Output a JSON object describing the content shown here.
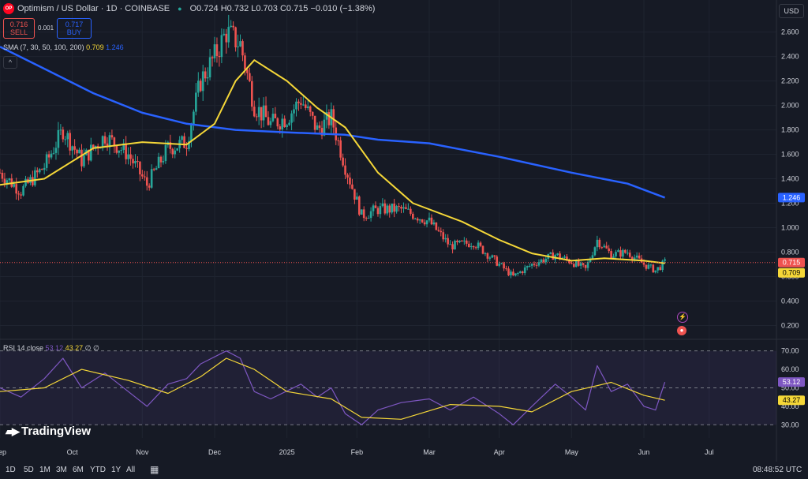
{
  "header": {
    "symbol": "Optimism / US Dollar · 1D · COINBASE",
    "logo": "OP",
    "ohlc": "O0.724 H0.732 L0.703 C0.715 −0.010 (−1.38%)",
    "sell_price": "0.716",
    "sell_label": "SELL",
    "buy_price": "0.717",
    "buy_label": "BUY",
    "spread": "0.001"
  },
  "sma_legend": {
    "label": "SMA (7, 30, 50, 100, 200)",
    "v1": "0.709",
    "v2": "1.246"
  },
  "rsi_legend": {
    "label": "RSI 14 close",
    "v1": "53.12",
    "v2": "43.27",
    "extra": "∅ ∅"
  },
  "currency_button": "USD",
  "watermark": "TradingView",
  "timeframes": [
    "1D",
    "5D",
    "1M",
    "3M",
    "6M",
    "YTD",
    "1Y",
    "All"
  ],
  "clock": "08:48:52 UTC",
  "colors": {
    "up": "#26a69a",
    "down": "#ef5350",
    "sma_fast": "#f5d738",
    "sma_slow": "#2962ff",
    "rsi": "#7e57c2",
    "rsi_ma": "#f5d738"
  },
  "chart_data": [
    {
      "type": "candlestick",
      "title": "Optimism / US Dollar · 1D · COINBASE",
      "x_ticks": [
        "Sep",
        "Oct",
        "Nov",
        "Dec",
        "2025",
        "Feb",
        "Mar",
        "Apr",
        "May",
        "Jun",
        "Jul"
      ],
      "y_ticks": [
        "2.600",
        "2.400",
        "2.200",
        "2.000",
        "1.800",
        "1.600",
        "1.400",
        "1.200",
        "1.000",
        "0.800",
        "0.600",
        "0.400",
        "0.200"
      ],
      "ylim": [
        0.1,
        2.72
      ],
      "price_key": [
        [
          "Sep 1",
          1.45
        ],
        [
          "Sep 10",
          1.3
        ],
        [
          "Sep 20",
          1.5
        ],
        [
          "Sep 28",
          1.8
        ],
        [
          "Oct 5",
          1.55
        ],
        [
          "Oct 15",
          1.75
        ],
        [
          "Oct 25",
          1.6
        ],
        [
          "Nov 3",
          1.35
        ],
        [
          "Nov 12",
          1.65
        ],
        [
          "Nov 20",
          1.7
        ],
        [
          "Nov 26",
          2.2
        ],
        [
          "Dec 1",
          2.4
        ],
        [
          "Dec 6",
          2.6
        ],
        [
          "Dec 12",
          2.5
        ],
        [
          "Dec 18",
          2.0
        ],
        [
          "Dec 25",
          1.85
        ],
        [
          "Jan 1",
          1.9
        ],
        [
          "Jan 7",
          2.05
        ],
        [
          "Jan 14",
          1.8
        ],
        [
          "Jan 20",
          1.9
        ],
        [
          "Jan 26",
          1.5
        ],
        [
          "Feb 3",
          1.1
        ],
        [
          "Feb 10",
          1.15
        ],
        [
          "Feb 20",
          1.15
        ],
        [
          "Mar 1",
          1.05
        ],
        [
          "Mar 10",
          0.85
        ],
        [
          "Mar 20",
          0.88
        ],
        [
          "Apr 1",
          0.7
        ],
        [
          "Apr 7",
          0.6
        ],
        [
          "Apr 15",
          0.7
        ],
        [
          "Apr 25",
          0.78
        ],
        [
          "May 1",
          0.72
        ],
        [
          "May 7",
          0.66
        ],
        [
          "May 12",
          0.9
        ],
        [
          "May 18",
          0.78
        ],
        [
          "May 25",
          0.8
        ],
        [
          "Jun 1",
          0.7
        ],
        [
          "Jun 6",
          0.65
        ],
        [
          "Jun 10",
          0.715
        ]
      ],
      "sma_fast": [
        [
          "Sep 1",
          1.35
        ],
        [
          "Sep 20",
          1.4
        ],
        [
          "Oct 10",
          1.65
        ],
        [
          "Nov 1",
          1.7
        ],
        [
          "Nov 20",
          1.68
        ],
        [
          "Dec 1",
          1.85
        ],
        [
          "Dec 10",
          2.2
        ],
        [
          "Dec 18",
          2.37
        ],
        [
          "Jan 1",
          2.2
        ],
        [
          "Jan 14",
          1.98
        ],
        [
          "Jan 26",
          1.82
        ],
        [
          "Feb 10",
          1.45
        ],
        [
          "Feb 25",
          1.2
        ],
        [
          "Mar 15",
          1.05
        ],
        [
          "Apr 1",
          0.9
        ],
        [
          "Apr 15",
          0.79
        ],
        [
          "May 1",
          0.73
        ],
        [
          "May 15",
          0.75
        ],
        [
          "Jun 1",
          0.73
        ],
        [
          "Jun 10",
          0.709
        ]
      ],
      "sma_slow": [
        [
          "Sep 1",
          2.48
        ],
        [
          "Sep 20",
          2.3
        ],
        [
          "Oct 10",
          2.1
        ],
        [
          "Nov 1",
          1.94
        ],
        [
          "Nov 20",
          1.85
        ],
        [
          "Dec 10",
          1.8
        ],
        [
          "Jan 1",
          1.78
        ],
        [
          "Jan 26",
          1.76
        ],
        [
          "Feb 10",
          1.72
        ],
        [
          "Mar 1",
          1.69
        ],
        [
          "Apr 1",
          1.58
        ],
        [
          "May 1",
          1.45
        ],
        [
          "May 25",
          1.36
        ],
        [
          "Jun 10",
          1.246
        ]
      ],
      "last_price": 0.715,
      "last_sma_fast": 0.709,
      "last_sma_slow": 1.246
    },
    {
      "type": "line",
      "title": "RSI 14 close",
      "y_ticks": [
        "70.00",
        "60.00",
        "50.00",
        "40.00",
        "30.00"
      ],
      "ylim": [
        25,
        72
      ],
      "bands": [
        30,
        50,
        70
      ],
      "rsi": [
        [
          "Sep 1",
          50
        ],
        [
          "Sep 10",
          45
        ],
        [
          "Sep 20",
          55
        ],
        [
          "Sep 28",
          66
        ],
        [
          "Oct 5",
          50
        ],
        [
          "Oct 15",
          58
        ],
        [
          "Oct 25",
          48
        ],
        [
          "Nov 3",
          40
        ],
        [
          "Nov 12",
          52
        ],
        [
          "Nov 20",
          55
        ],
        [
          "Nov 26",
          63
        ],
        [
          "Dec 6",
          70
        ],
        [
          "Dec 12",
          66
        ],
        [
          "Dec 18",
          48
        ],
        [
          "Dec 25",
          44
        ],
        [
          "Jan 7",
          52
        ],
        [
          "Jan 14",
          45
        ],
        [
          "Jan 20",
          50
        ],
        [
          "Jan 26",
          36
        ],
        [
          "Feb 3",
          30
        ],
        [
          "Feb 10",
          38
        ],
        [
          "Feb 20",
          42
        ],
        [
          "Mar 1",
          44
        ],
        [
          "Mar 10",
          38
        ],
        [
          "Mar 20",
          45
        ],
        [
          "Apr 1",
          36
        ],
        [
          "Apr 7",
          30
        ],
        [
          "Apr 15",
          40
        ],
        [
          "Apr 25",
          52
        ],
        [
          "May 1",
          45
        ],
        [
          "May 7",
          38
        ],
        [
          "May 12",
          62
        ],
        [
          "May 18",
          48
        ],
        [
          "May 25",
          52
        ],
        [
          "Jun 1",
          40
        ],
        [
          "Jun 6",
          38
        ],
        [
          "Jun 10",
          53.12
        ]
      ],
      "rsi_ma": [
        [
          "Sep 1",
          48
        ],
        [
          "Sep 20",
          50
        ],
        [
          "Oct 5",
          60
        ],
        [
          "Oct 25",
          54
        ],
        [
          "Nov 12",
          47
        ],
        [
          "Nov 26",
          56
        ],
        [
          "Dec 6",
          66
        ],
        [
          "Dec 18",
          60
        ],
        [
          "Jan 1",
          48
        ],
        [
          "Jan 20",
          44
        ],
        [
          "Feb 3",
          34
        ],
        [
          "Feb 20",
          33
        ],
        [
          "Mar 10",
          41
        ],
        [
          "Apr 1",
          40
        ],
        [
          "Apr 15",
          37
        ],
        [
          "May 1",
          48
        ],
        [
          "May 18",
          53
        ],
        [
          "Jun 1",
          46
        ],
        [
          "Jun 10",
          43.27
        ]
      ],
      "last_rsi": 53.12,
      "last_rsi_ma": 43.27
    }
  ]
}
